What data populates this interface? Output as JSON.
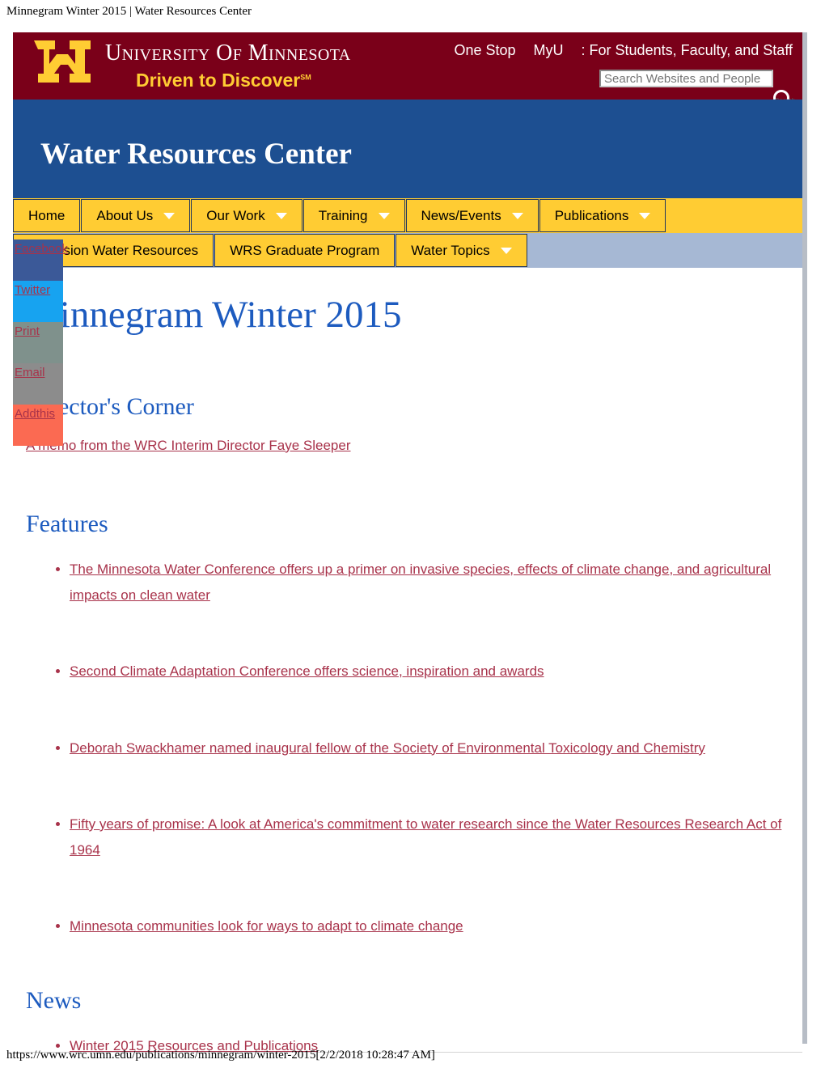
{
  "browser": {
    "print_header": "Minnegram Winter 2015 | Water Resources Center",
    "footer_url": "https://www.wrc.umn.edu/publications/minnegram/winter-2015[2/2/2018 10:28:47 AM]"
  },
  "colors": {
    "maroon": "#7a0019",
    "gold": "#ffcc33",
    "blue": "#1d4f91",
    "nav_row2_bg": "#a6b8d4",
    "link_red": "#a8324a",
    "heading_blue": "#1d5bbf"
  },
  "umn_header": {
    "logo_alt": "University of Minnesota",
    "wordmark_line1": "University of Minnesota",
    "wordmark_line2": "Driven to Discover",
    "wordmark_sm": "SM",
    "links": [
      {
        "label": "One Stop"
      },
      {
        "label": "MyU"
      }
    ],
    "tagline": ": For Students, Faculty, and Staff",
    "search": {
      "placeholder": "Search Websites and People",
      "value": "",
      "button_label": "Search"
    }
  },
  "site": {
    "title": "Water Resources Center"
  },
  "nav": {
    "row1": [
      {
        "label": "Home",
        "has_caret": false
      },
      {
        "label": "About Us",
        "has_caret": true
      },
      {
        "label": "Our Work",
        "has_caret": true
      },
      {
        "label": "Training",
        "has_caret": true
      },
      {
        "label": "News/Events",
        "has_caret": true
      },
      {
        "label": "Publications",
        "has_caret": true
      }
    ],
    "row2": [
      {
        "label": "Extension Water Resources",
        "has_caret": false
      },
      {
        "label": "WRS Graduate Program",
        "has_caret": false
      },
      {
        "label": "Water Topics",
        "has_caret": true
      }
    ]
  },
  "share": [
    {
      "label": "Facebook",
      "color": "#3b5998"
    },
    {
      "label": "Twitter",
      "color": "#17a3f0"
    },
    {
      "label": "Print",
      "color": "#7f918c"
    },
    {
      "label": "Email",
      "color": "#8c8c8c"
    },
    {
      "label": "Addthis",
      "color": "#fb6a52"
    }
  ],
  "main": {
    "page_title": "Minnegram Winter 2015",
    "directors_corner": {
      "heading": "Director's Corner",
      "memo_link": "A memo from the WRC Interim Director Faye Sleeper"
    },
    "features": {
      "heading": "Features",
      "items": [
        "The Minnesota Water Conference offers up a primer on invasive species, effects of climate change, and agricultural impacts on clean water",
        "Second Climate Adaptation Conference offers science, inspiration and awards",
        "Deborah Swackhamer named inaugural fellow of the Society of Environmental Toxicology and Chemistry",
        "Fifty years of promise: A look at America's commitment to water research since the Water Resources Research Act of 1964",
        "Minnesota communities look for ways to adapt to climate change"
      ]
    },
    "news": {
      "heading": "News",
      "items": [
        "Winter 2015 Resources and Publications"
      ]
    }
  }
}
